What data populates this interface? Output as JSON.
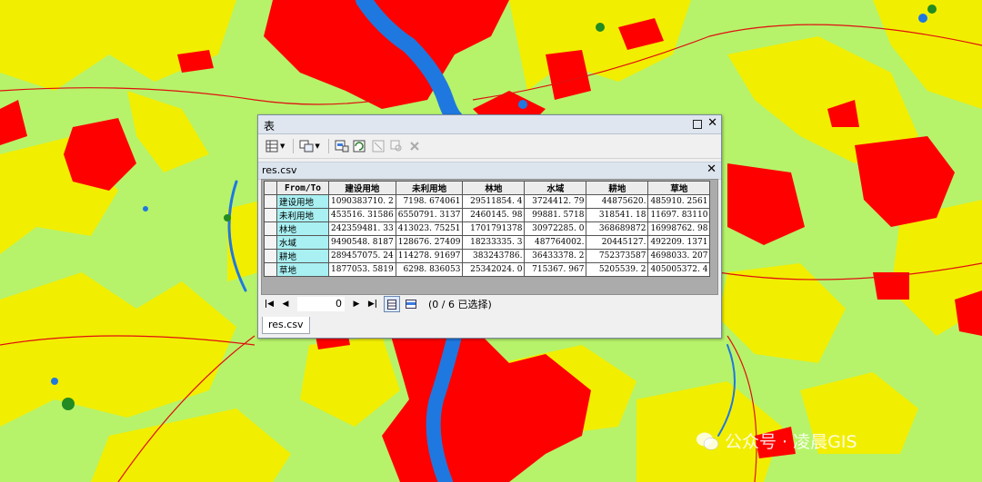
{
  "window": {
    "title": "表"
  },
  "table_tab": {
    "name": "res.csv"
  },
  "grid": {
    "headers": [
      "From/To",
      "建设用地",
      "未利用地",
      "林地",
      "水域",
      "耕地",
      "草地"
    ],
    "rows": [
      {
        "label": "建设用地",
        "values": [
          "1090383710. 2",
          "7198. 674061",
          "29511854. 4",
          "3724412. 79",
          "44875620.",
          "485910. 2561"
        ]
      },
      {
        "label": "未利用地",
        "values": [
          "453516. 31586",
          "6550791. 3137",
          "2460145. 98",
          "99881. 5718",
          "318541. 18",
          "11697. 83110"
        ]
      },
      {
        "label": "林地",
        "values": [
          "242359481. 33",
          "413023. 75251",
          "1701791378",
          "30972285. 0",
          "368689872",
          "16998762. 98"
        ]
      },
      {
        "label": "水域",
        "values": [
          "9490548. 8187",
          "128676. 27409",
          "18233335. 3",
          "487764002.",
          "20445127.",
          "492209. 1371"
        ]
      },
      {
        "label": "耕地",
        "values": [
          "289457075. 24",
          "114278. 91697",
          "383243786.",
          "36433378. 2",
          "752373587",
          "4698033. 207"
        ]
      },
      {
        "label": "草地",
        "values": [
          "1877053. 5819",
          "6298. 836053",
          "25342024. 0",
          "715367. 967",
          "5205539. 2",
          "405005372. 4"
        ]
      }
    ]
  },
  "nav": {
    "record": "0",
    "selection": "(0 / 6 已选择)"
  },
  "bottom_tab": "res.csv",
  "watermark": {
    "text": "公众号 · 凌晨GIS"
  },
  "colors": {
    "built": "#ff0000",
    "unused": "#e6e600",
    "forest": "#a4f26e",
    "water": "#1f78e0",
    "farm": "#ffff00",
    "grass": "#228b22"
  },
  "icons": [
    "table-options-icon",
    "related-tables-icon",
    "select-by-attributes-icon",
    "switch-selection-icon",
    "clear-selection-icon",
    "zoom-to-selected-icon",
    "delete-selected-icon",
    "first-record-icon",
    "previous-record-icon",
    "next-record-icon",
    "last-record-icon",
    "show-all-records-icon",
    "show-selected-records-icon"
  ]
}
